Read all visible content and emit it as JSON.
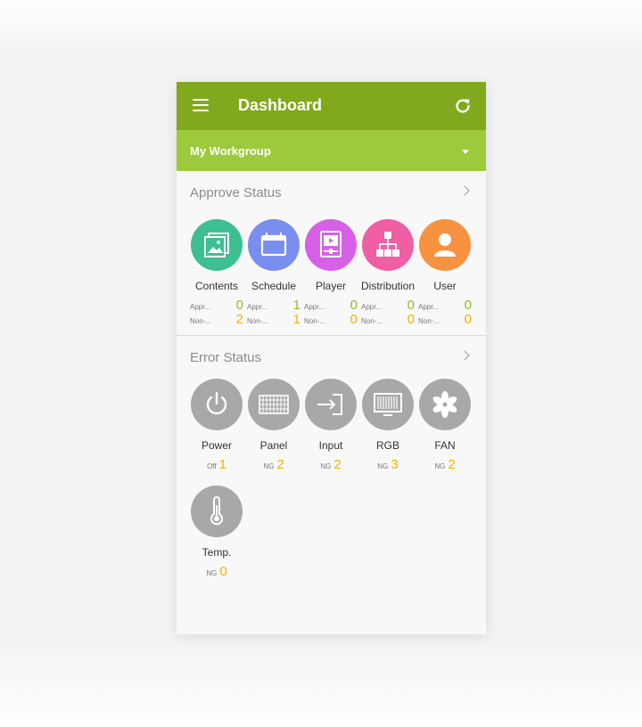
{
  "header": {
    "title": "Dashboard",
    "menu_icon": "hamburger-menu-icon",
    "refresh_icon": "refresh-icon"
  },
  "workgroup": {
    "label": "My Workgroup",
    "dropdown_icon": "caret-down-icon"
  },
  "approve": {
    "title": "Approve Status",
    "items": [
      {
        "label": "Contents",
        "icon": "image-icon",
        "color": "#3dbf91",
        "appr_label": "Appr...",
        "appr_value": "0",
        "non_label": "Non-...",
        "non_value": "2"
      },
      {
        "label": "Schedule",
        "icon": "calendar-icon",
        "color": "#7a8ef0",
        "appr_label": "Appr...",
        "appr_value": "1",
        "non_label": "Non-...",
        "non_value": "1"
      },
      {
        "label": "Player",
        "icon": "player-icon",
        "color": "#d760e6",
        "appr_label": "Appr...",
        "appr_value": "0",
        "non_label": "Non-...",
        "non_value": "0"
      },
      {
        "label": "Distribution",
        "icon": "hierarchy-icon",
        "color": "#f05ea3",
        "appr_label": "Appr...",
        "appr_value": "0",
        "non_label": "Non-...",
        "non_value": "0"
      },
      {
        "label": "User",
        "icon": "user-icon",
        "color": "#f79241",
        "appr_label": "Appr...",
        "appr_value": "0",
        "non_label": "Non-...",
        "non_value": "0"
      }
    ]
  },
  "error": {
    "title": "Error Status",
    "items": [
      {
        "label": "Power",
        "icon": "power-icon",
        "status_label": "Off",
        "value": "1"
      },
      {
        "label": "Panel",
        "icon": "panel-grid-icon",
        "status_label": "NG",
        "value": "2"
      },
      {
        "label": "Input",
        "icon": "input-icon",
        "status_label": "NG",
        "value": "2"
      },
      {
        "label": "RGB",
        "icon": "monitor-icon",
        "status_label": "NG",
        "value": "3"
      },
      {
        "label": "FAN",
        "icon": "fan-icon",
        "status_label": "NG",
        "value": "2"
      },
      {
        "label": "Temp.",
        "icon": "thermometer-icon",
        "status_label": "NG",
        "value": "0"
      }
    ]
  },
  "colors": {
    "topbar": "#82a81d",
    "workgroup": "#9dca3c",
    "error_circle": "#a8a8a8",
    "approved_value": "#8fbd2e",
    "pending_value": "#f1b300"
  }
}
